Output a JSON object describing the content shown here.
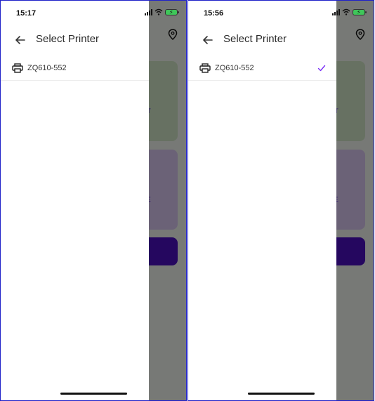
{
  "screens": [
    {
      "status_time": "15:17",
      "title": "Select Printer",
      "printers": [
        {
          "name": "ZQ610-552",
          "selected": false
        }
      ],
      "bg_card1_text": "UT",
      "bg_card2_text": "E"
    },
    {
      "status_time": "15:56",
      "title": "Select Printer",
      "printers": [
        {
          "name": "ZQ610-552",
          "selected": true
        }
      ],
      "bg_card1_text": "UT",
      "bg_card2_text": "E"
    }
  ],
  "colors": {
    "accent": "#7b2ff7",
    "frame_border": "#1f21c9",
    "bg_button": "#4a0fbf"
  },
  "icons": {
    "back": "arrow-left-icon",
    "printer": "printer-icon",
    "check": "check-icon",
    "location": "location-pin-icon"
  }
}
